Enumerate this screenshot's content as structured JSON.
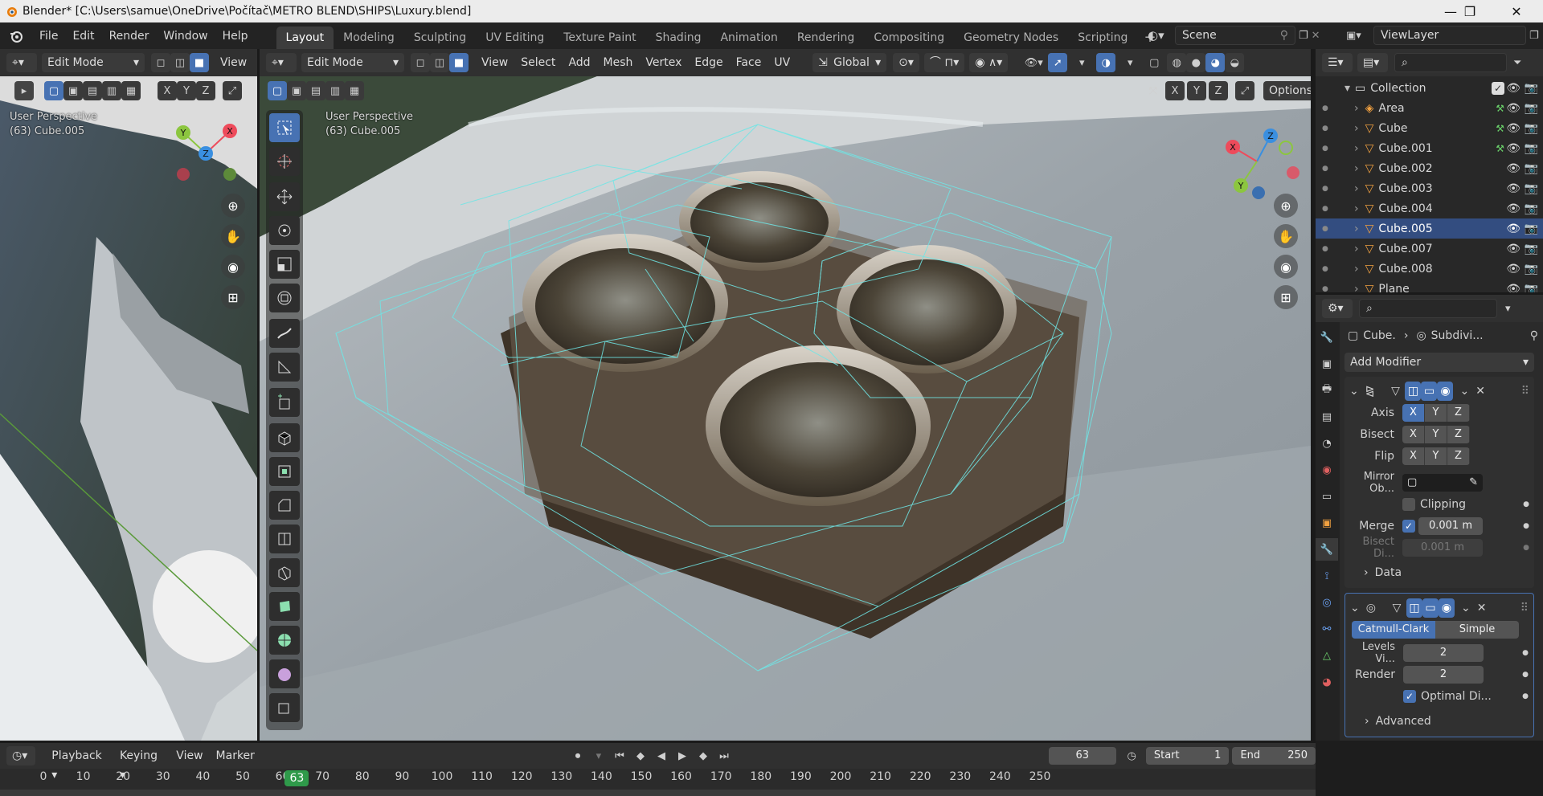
{
  "window": {
    "title": "Blender* [C:\\Users\\samue\\OneDrive\\Počítač\\METRO BLEND\\SHIPS\\Luxury.blend]",
    "minimize": "—",
    "maximize": "❐",
    "close": "✕"
  },
  "menubar": {
    "items": [
      "File",
      "Edit",
      "Render",
      "Window",
      "Help"
    ]
  },
  "workspaces": [
    "Layout",
    "Modeling",
    "Sculpting",
    "UV Editing",
    "Texture Paint",
    "Shading",
    "Animation",
    "Rendering",
    "Compositing",
    "Geometry Nodes",
    "Scripting"
  ],
  "scene": {
    "name": "Scene"
  },
  "viewlayer": {
    "name": "ViewLayer"
  },
  "left_viewport": {
    "mode": "Edit Mode",
    "view_menu": "View",
    "axes": [
      "X",
      "Y",
      "Z"
    ],
    "label_line1": "User Perspective",
    "label_line2": "(63) Cube.005",
    "gizmo": {
      "x": "X",
      "y": "Y",
      "z": "Z"
    }
  },
  "main_viewport": {
    "mode": "Edit Mode",
    "menus": [
      "View",
      "Select",
      "Add",
      "Mesh",
      "Vertex",
      "Edge",
      "Face",
      "UV"
    ],
    "orientation": "Global",
    "axes": [
      "X",
      "Y",
      "Z"
    ],
    "options": "Options",
    "label_line1": "User Perspective",
    "label_line2": "(63) Cube.005",
    "gizmo": {
      "x": "X",
      "y": "Y",
      "z": "Z"
    }
  },
  "outliner": {
    "collection": "Collection",
    "items": [
      {
        "name": "Area",
        "selected": false
      },
      {
        "name": "Cube",
        "selected": false
      },
      {
        "name": "Cube.001",
        "selected": false
      },
      {
        "name": "Cube.002",
        "selected": false
      },
      {
        "name": "Cube.003",
        "selected": false
      },
      {
        "name": "Cube.004",
        "selected": false
      },
      {
        "name": "Cube.005",
        "selected": true
      },
      {
        "name": "Cube.007",
        "selected": false
      },
      {
        "name": "Cube.008",
        "selected": false
      },
      {
        "name": "Plane",
        "selected": false
      }
    ]
  },
  "properties": {
    "breadcrumb_object": "Cube.",
    "breadcrumb_modifier": "Subdivi...",
    "add_modifier": "Add Modifier",
    "mirror": {
      "axis_label": "Axis",
      "bisect_label": "Bisect",
      "flip_label": "Flip",
      "axis_buttons": [
        "X",
        "Y",
        "Z"
      ],
      "mirror_object_label": "Mirror Ob...",
      "clipping_label": "Clipping",
      "merge_label": "Merge",
      "merge_value": "0.001 m",
      "bisect_distance_label": "Bisect Di...",
      "bisect_distance_value": "0.001 m",
      "data_label": "Data"
    },
    "subsurf": {
      "catmull": "Catmull-Clark",
      "simple": "Simple",
      "levels_label": "Levels Vi...",
      "levels_value": "2",
      "render_label": "Render",
      "render_value": "2",
      "optimal_label": "Optimal Di...",
      "advanced_label": "Advanced"
    }
  },
  "timeline": {
    "menus": [
      "Playback",
      "Keying",
      "View",
      "Marker"
    ],
    "current_frame": "63",
    "start_label": "Start",
    "start_value": "1",
    "end_label": "End",
    "end_value": "250",
    "ruler_ticks": [
      "0",
      "10",
      "20",
      "30",
      "40",
      "50",
      "60",
      "70",
      "80",
      "90",
      "100",
      "110",
      "120",
      "130",
      "140",
      "150",
      "160",
      "170",
      "180",
      "190",
      "200",
      "210",
      "220",
      "230",
      "240",
      "250"
    ]
  },
  "colors": {
    "accent": "#4772b3",
    "wire": "#5fe0e0",
    "active_frame": "#2f9a4a"
  }
}
